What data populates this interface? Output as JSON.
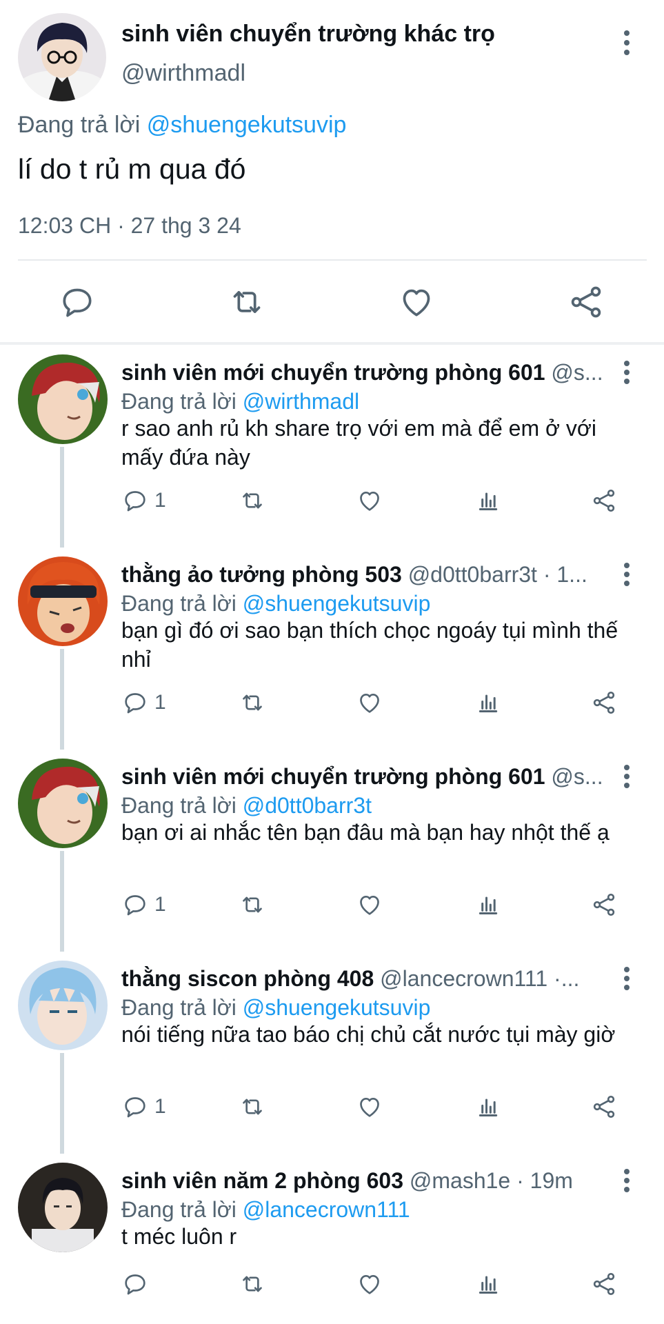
{
  "main_tweet": {
    "name": "sinh viên chuyển trường khác trọ",
    "handle": "@wirthmadl",
    "reply_prefix": "Đang trả lời",
    "reply_to": "@shuengekutsuvip",
    "text": "lí do t rủ m qua đó",
    "timestamp": "12:03 CH · 27 thg 3 24",
    "icons": [
      "comment-icon",
      "retweet-icon",
      "like-icon",
      "share-icon",
      "more-icon"
    ]
  },
  "replies": [
    {
      "name": "sinh viên mới chuyển trường phòng 601",
      "handle": "@s...",
      "reply_prefix": "Đang trả lời",
      "reply_to": "@wirthmadl",
      "text": "r sao anh rủ kh share trọ với em mà để em ở với mấy đứa này",
      "reply_count": "1",
      "avatar_colors": {
        "bg": "#3a6b22",
        "hair": "#b02a2a",
        "face": "#f3d6c0"
      }
    },
    {
      "name": "thằng ảo tưởng phòng 503",
      "handle": "@d0tt0barr3t · 1...",
      "reply_prefix": "Đang trả lời",
      "reply_to": "@shuengekutsuvip",
      "text": "bạn gì đó ơi sao bạn thích chọc ngoáy tụi mình thế nhỉ",
      "reply_count": "1",
      "avatar_colors": {
        "bg": "#d84b1c",
        "hair": "#e0531f",
        "face": "#f2c9a3"
      }
    },
    {
      "name": "sinh viên mới chuyển trường phòng 601",
      "handle": "@s...",
      "reply_prefix": "Đang trả lời",
      "reply_to": "@d0tt0barr3t",
      "text": "bạn ơi ai nhắc tên bạn đâu mà bạn hay nhột thế ạ",
      "reply_count": "1",
      "avatar_colors": {
        "bg": "#3a6b22",
        "hair": "#b02a2a",
        "face": "#f3d6c0"
      }
    },
    {
      "name": "thằng siscon phòng 408",
      "handle": "@lancecrown111 ·...",
      "reply_prefix": "Đang trả lời",
      "reply_to": "@shuengekutsuvip",
      "text": "nói tiếng nữa tao báo chị chủ cắt nước tụi mày giờ",
      "reply_count": "1",
      "avatar_colors": {
        "bg": "#cfe0f0",
        "hair": "#8fc3e8",
        "face": "#f4e1d4"
      }
    },
    {
      "name": "sinh viên năm 2 phòng 603",
      "handle": "@mash1e · 19m",
      "reply_prefix": "Đang trả lời",
      "reply_to": "@lancecrown111",
      "text": "t méc luôn r",
      "reply_count": "",
      "avatar_colors": {
        "bg": "#2a2622",
        "hair": "#15151c",
        "face": "#f0dccb"
      }
    }
  ],
  "colors": {
    "link": "#1d9bf0",
    "secondary": "#536471",
    "primary": "#0f1419"
  }
}
